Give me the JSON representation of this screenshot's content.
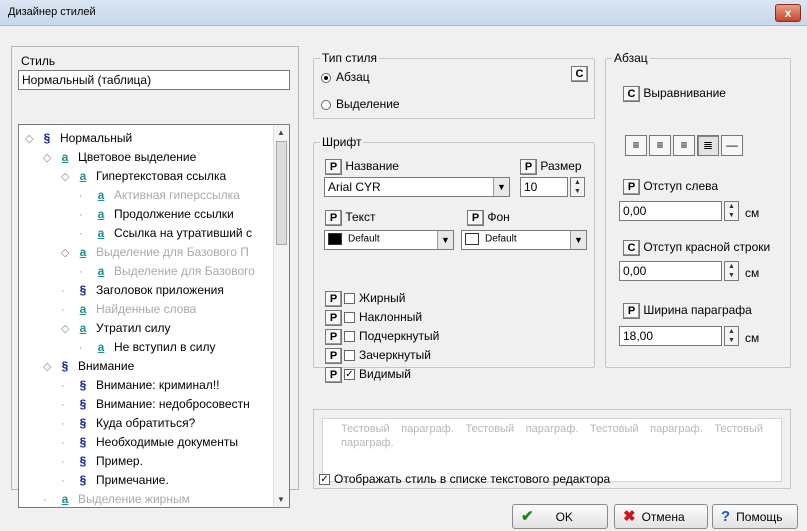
{
  "window": {
    "title": "Дизайнер стилей",
    "close_label": "x"
  },
  "left": {
    "style_label": "Стиль",
    "style_value": "Нормальный (таблица)",
    "tree": [
      {
        "label": "Нормальный",
        "icon": "§",
        "kind": "s",
        "level": 0,
        "expand": "◇",
        "gray": false
      },
      {
        "label": "Цветовое выделение",
        "icon": "a",
        "kind": "a",
        "level": 1,
        "expand": "◇",
        "gray": false
      },
      {
        "label": "Гипертекстовая ссылка",
        "icon": "a",
        "kind": "a",
        "level": 2,
        "expand": "◇",
        "gray": false
      },
      {
        "label": "Активная гиперссылка",
        "icon": "a",
        "kind": "a",
        "level": 3,
        "expand": "",
        "gray": true
      },
      {
        "label": "Продолжение ссылки",
        "icon": "a",
        "kind": "a",
        "level": 3,
        "expand": "",
        "gray": false
      },
      {
        "label": "Ссылка на утративший с",
        "icon": "a",
        "kind": "a",
        "level": 3,
        "expand": "",
        "gray": false
      },
      {
        "label": "Выделение для Базового П",
        "icon": "a",
        "kind": "a",
        "level": 2,
        "expand": "◇",
        "gray": true
      },
      {
        "label": "Выделение для Базового",
        "icon": "a",
        "kind": "a",
        "level": 3,
        "expand": "",
        "gray": true
      },
      {
        "label": "Заголовок приложения",
        "icon": "§",
        "kind": "s",
        "level": 2,
        "expand": "",
        "gray": false
      },
      {
        "label": "Найденные слова",
        "icon": "a",
        "kind": "a",
        "level": 2,
        "expand": "",
        "gray": true
      },
      {
        "label": "Утратил силу",
        "icon": "a",
        "kind": "a",
        "level": 2,
        "expand": "◇",
        "gray": false
      },
      {
        "label": "Не вступил в силу",
        "icon": "a",
        "kind": "a",
        "level": 3,
        "expand": "",
        "gray": false
      },
      {
        "label": "Внимание",
        "icon": "§",
        "kind": "s",
        "level": 1,
        "expand": "◇",
        "gray": false
      },
      {
        "label": "Внимание: криминал!!",
        "icon": "§",
        "kind": "s",
        "level": 2,
        "expand": "",
        "gray": false
      },
      {
        "label": "Внимание: недобросовестн",
        "icon": "§",
        "kind": "s",
        "level": 2,
        "expand": "",
        "gray": false
      },
      {
        "label": "Куда обратиться?",
        "icon": "§",
        "kind": "s",
        "level": 2,
        "expand": "",
        "gray": false
      },
      {
        "label": "Необходимые документы",
        "icon": "§",
        "kind": "s",
        "level": 2,
        "expand": "",
        "gray": false
      },
      {
        "label": "Пример.",
        "icon": "§",
        "kind": "s",
        "level": 2,
        "expand": "",
        "gray": false
      },
      {
        "label": "Примечание.",
        "icon": "§",
        "kind": "s",
        "level": 2,
        "expand": "",
        "gray": false
      },
      {
        "label": "Выделение жирным",
        "icon": "a",
        "kind": "a",
        "level": 1,
        "expand": "",
        "gray": true
      }
    ]
  },
  "style_type": {
    "legend": "Тип стиля",
    "c_label": "C",
    "options": [
      {
        "label": "Абзац",
        "selected": true
      },
      {
        "label": "Выделение",
        "selected": false
      }
    ]
  },
  "font": {
    "legend": "Шрифт",
    "p_label": "P",
    "name_label": "Название",
    "name_value": "Arial CYR",
    "size_label": "Размер",
    "size_value": "10",
    "text_label": "Текст",
    "text_value": "Default",
    "bg_label": "Фон",
    "bg_value": "Default",
    "text_swatch": "#000000",
    "bg_swatch": "#ffffff",
    "checks": [
      {
        "label": "Жирный",
        "checked": false
      },
      {
        "label": "Наклонный",
        "checked": false
      },
      {
        "label": "Подчеркнутый",
        "checked": false
      },
      {
        "label": "Зачеркнутый",
        "checked": false
      },
      {
        "label": "Видимый",
        "checked": true
      }
    ]
  },
  "paragraph": {
    "legend": "Абзац",
    "c_label": "C",
    "p_label": "P",
    "align_label": "Выравнивание",
    "align_buttons": [
      "align-left",
      "align-center",
      "align-right",
      "align-justify",
      "no-align"
    ],
    "align_selected": 3,
    "left_indent_label": "Отступ слева",
    "left_indent_value": "0,00",
    "first_indent_label": "Отступ красной строки",
    "first_indent_value": "0,00",
    "width_label": "Ширина параграфа",
    "width_value": "18,00",
    "unit": "см"
  },
  "preview_text": "Тестовый параграф. Тестовый параграф. Тестовый параграф. Тестовый параграф.",
  "show_in_list": {
    "label": "Отображать стиль в списке текстового редактора",
    "checked": true
  },
  "buttons": {
    "ok": "OK",
    "cancel": "Отмена",
    "help": "Помощь"
  }
}
